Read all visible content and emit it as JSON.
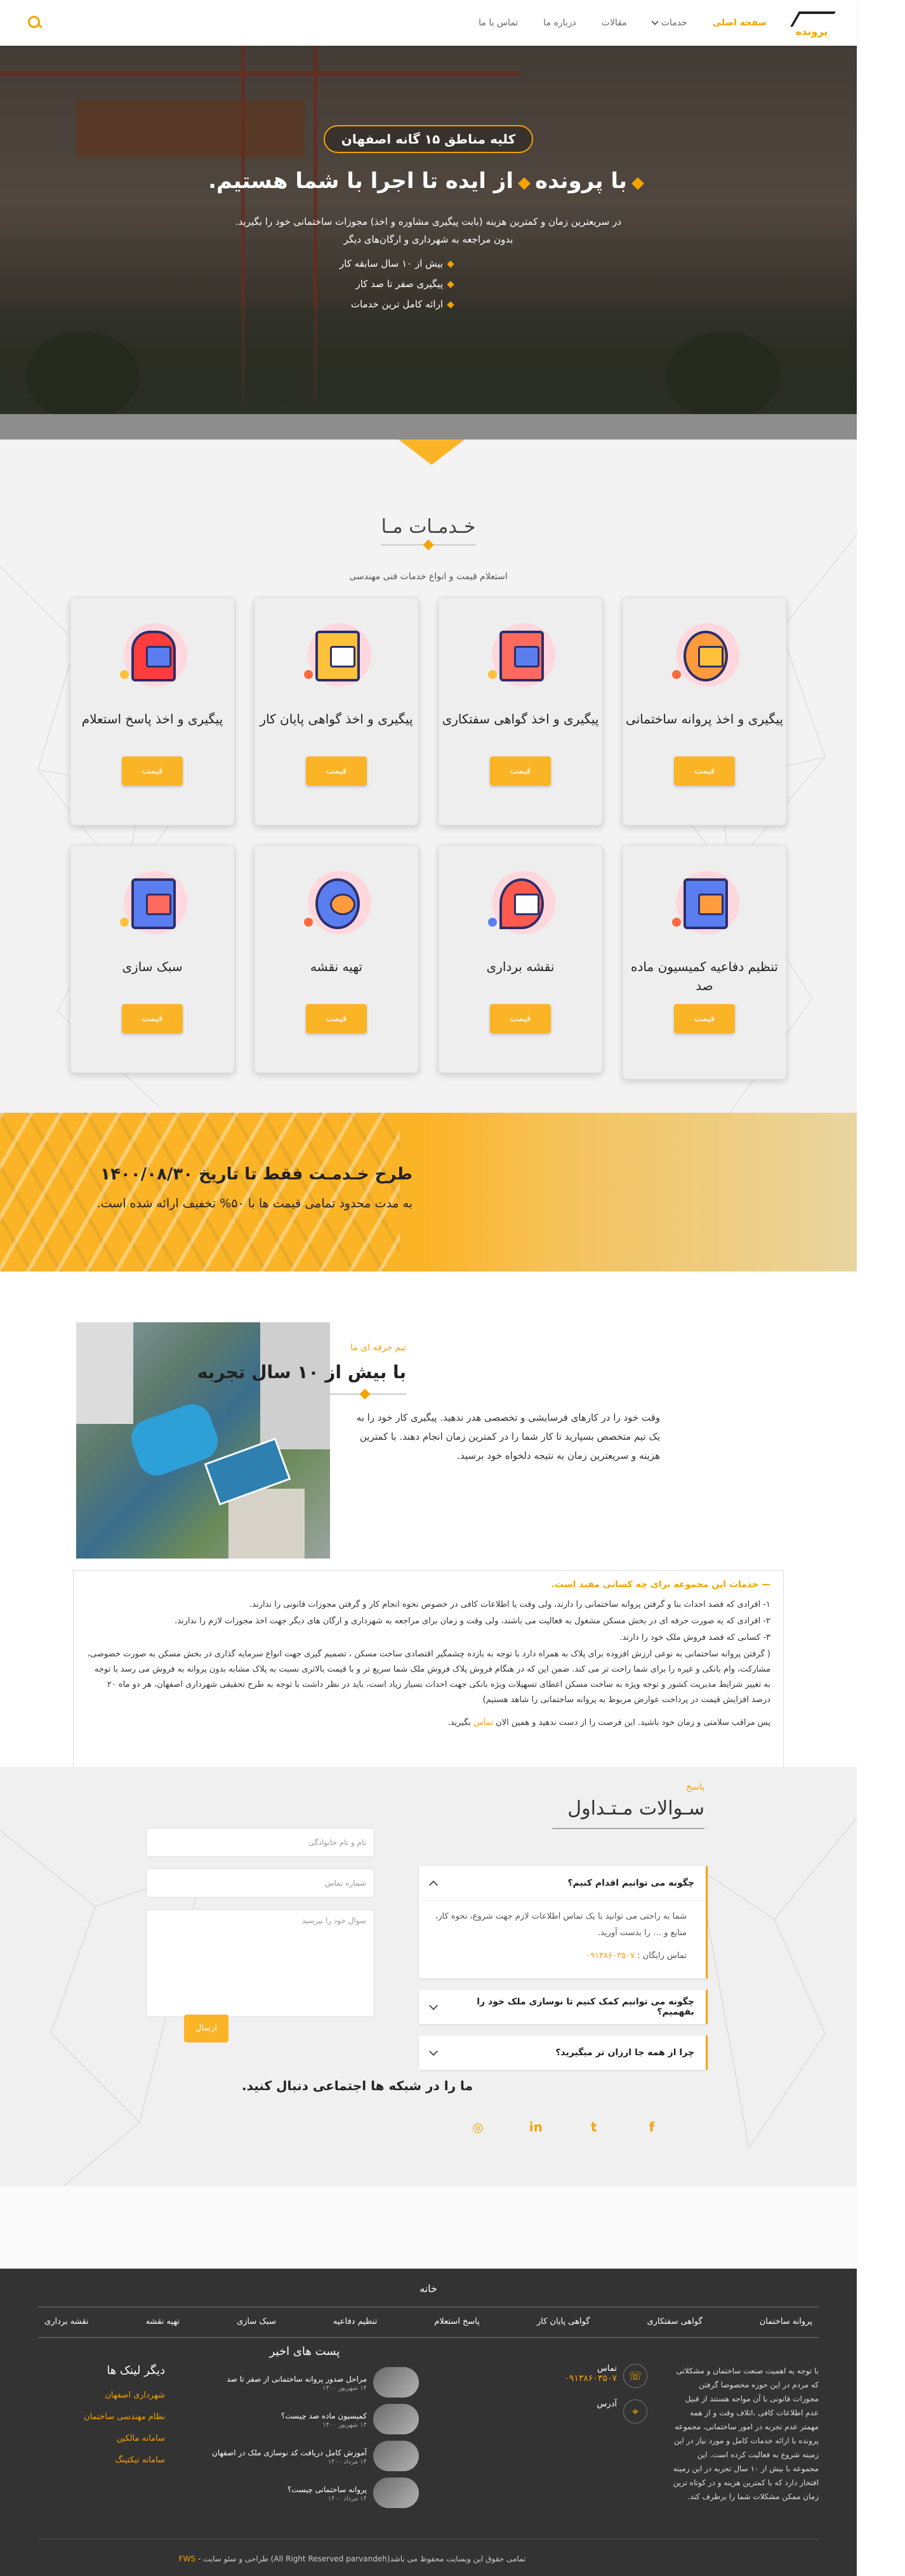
{
  "header": {
    "logo_text": "پرونده",
    "nav": [
      "صفحه اصلی",
      "خدمات",
      "مقالات",
      "درباره ما",
      "تماس با ما"
    ]
  },
  "hero": {
    "pill": "کلیه مناطق ۱۵ گانه اصفهان",
    "title_a": "با پرونده",
    "title_b": "از ایده تا اجرا با شما هستیم.",
    "lead1": "در سریعترین زمان و کمترین هزینه (بابت پیگیری مشاوره و اخذ) مجوزات ساختمانی خود را بگیرید.",
    "lead2": "بدون مراجعه به شهرداری و ارگان‌های دیگر",
    "bullets": [
      "بیش از ۱۰ سال سابقه کار",
      "پیگیری صفر تا صد کار",
      "ارائه کامل ترین خدمات"
    ]
  },
  "services": {
    "title": "خـدمـات مـا",
    "subtitle": "استعلام قیمت و انواع خدمات فنی مهندسی",
    "cards": [
      {
        "title": "پیگیری و اخذ پروانه ساختمانی",
        "btn": "قیمت"
      },
      {
        "title": "پیگیری و اخذ گواهی سفتکاری",
        "btn": "قیمت"
      },
      {
        "title": "پیگیری و اخذ گواهی پایان کار",
        "btn": "قیمت"
      },
      {
        "title": "پیگیری و اخذ پاسخ استعلام",
        "btn": "قیمت"
      },
      {
        "title": "تنظیم دفاعیه کمیسیون ماده صد",
        "btn": "قیمت"
      },
      {
        "title": "نقشه برداری",
        "btn": "قیمت"
      },
      {
        "title": "تهیه نقشه",
        "btn": "قیمت"
      },
      {
        "title": "سبک سازی",
        "btn": "قیمت"
      }
    ]
  },
  "promo": {
    "line1": "طرح خـدمـت فقط تا تاریخ ۱۴۰۰/۰۸/۳۰",
    "line2": "به مدت محدود تمامی قیمت ها با ۵۰% تخفیف ارائه شده است."
  },
  "about": {
    "kicker": "تیم حرفه ای ما",
    "title": "با بیش از ۱۰ سال تجربه",
    "paragraph": "وقت خود را در کارهای فرسایشی و تخصصی هدر ندهید. پیگیری کار خود را به یک تیم متخصص بسپارید تا کار شما را در کمترین زمان انجام دهند. با کمترین هزینه و سریعترین زمان به نتیجه دلخواه خود برسید.",
    "box_title": "خدمات این مجموعه برای چه کسانی مفید است.",
    "box_items": [
      "۱- افرادی که قصد احداث بنا و گرفتن پروانه ساختمانی را دارند، ولی وقت یا اطلاعات کافی در خصوص نحوه انجام کار و گرفتن مجوزات قانونی را ندارند.",
      "۲- افرادی که به صورت حرفه ای در بخش مسکن مشغول به فعالیت می باشند، ولی وقت و زمان برای مراجعه به شهرداری و ارگان های دیگر جهت اخذ مجوزات لازم را ندارند.",
      "۳- کسانی که قصد فروش ملک خود را دارند.",
      "( گرفتن پروانه ساختمانی به نوعی ارزش افزوده برای پلاک به همراه دارد با توجه به بازده چشمگیر اقتصادی ساخت مسکن ، تصمیم گیری جهت انواع سرمایه گذاری در بخش مسکن به صورت خصوصی، مشارکت، وام بانکی و غیره را برای شما راحت تر می کند. ضمن این که در هنگام فروش پلاک فروش ملک شما سریع تر و با قیمت بالاتری نسبت به پلاک مشابه بدون پروانه به فروش می رسد با توجه به تغییر شرایط مدیریت کشور و توجه ویژه به ساخت مسکن اعطای تسهیلات ویژه بانکی جهت احداث بسیار زیاد است، باید در نظر داشت با توجه به طرح تحقیقی شهرداری اصفهان، هر دو ماه ۲۰ درصد افزایش قیمت در پرداخت عوارض مربوط به پروانه ساختمانی را شاهد هستیم)"
    ],
    "cta_before": "پس مراقب سلامتی و زمان خود باشید. این فرصت را از دست ندهید و همین الان",
    "cta_link": "تماس",
    "cta_after": "بگیرید."
  },
  "faq": {
    "kicker": "پاسخ",
    "title": "سـوالات مـتـداول",
    "items": [
      {
        "q": "چگونه می توانیم اقدام کنیم؟",
        "a": "شما به راحتی می توانید با یک تماس اطلاعات لازم جهت شروع، نحوه کار، منابع و … را بدست آورید.",
        "phone_label": "تماس رایگان :",
        "phone": "۰۹۱۳۸۶۰۳۵۰۷"
      },
      {
        "q": "چگونه می توانیم کمک کنیم تا نوسازی ملک خود را بفهمیم؟"
      },
      {
        "q": "چرا از همه جا ارزان تر میگیرید؟"
      }
    ],
    "form": {
      "name_ph": "نام و نام خانوادگی",
      "phone_ph": "شماره تماس",
      "msg_ph": "سوال خود را بپرسید",
      "send": "ارسال"
    },
    "social_title": "ما را در شبکه ها اجتماعی دنبال کنید.",
    "social_icons": [
      "facebook-icon",
      "twitter-icon",
      "linkedin-icon",
      "instagram-icon"
    ]
  },
  "footer": {
    "title": "خانه",
    "links": [
      "پروانه ساختمان",
      "گواهی سفتکاری",
      "گواهی پایان کار",
      "پاسخ استعلام",
      "تنظیم دفاعیه",
      "سبک سازی",
      "تهیه نقشه",
      "نقشه برداری"
    ],
    "about_text": "با توجه به اهمیت صنعت ساختمان و مشکلاتی که مردم در این حوزه مخصوصا گرفتن مجوزات قانونی با آن مواجه هستند از قبیل عدم اطلاعات کافی ،اتلاف وقت و از همه مهمتر عدم تجربه در امور ساختمانی، مجموعه پرونده با ارائه خدمات کامل و مورد نیاز در این زمینه شروع به فعالیت کرده است. این مجموعه با بیش از ۱۰ سال تجربه در این زمینه افتخار دارد که با کمترین هزینه و در کوتاه ترین زمان ممکن مشکلات شما را برطرف کند.",
    "contact_label": "تماس",
    "contact_phone": "۰۹۱۳۸۶۰۳۵۰۷",
    "address_label": "آدرس",
    "posts_title": "پست های اخیر",
    "posts": [
      {
        "title": "مراحل صدور پروانه ساختمانی از صفر تا صد",
        "date": "۱۴ شهریور ۱۴۰۰"
      },
      {
        "title": "کمیسیون ماده صد چیست؟",
        "date": "۱۴ شهریور ۱۴۰۰"
      },
      {
        "title": "آموزش کامل دریافت کد نوسازی ملک در اصفهان",
        "date": "۱۴ مرداد ۱۴۰۰"
      },
      {
        "title": "پروانه ساختمانی چیست؟",
        "date": "۱۴ مرداد ۱۴۰۰"
      }
    ],
    "links_title": "دیگر لینک ها",
    "other_links": [
      "شهرداری اصفهان",
      "نظام مهندسی ساختمان",
      "سامانه مالکین",
      "سامانه تیکتینگ"
    ],
    "copyright": "تمامی حقوق این وبسایت محفوظ می باشد(All Right Reserved parvandeh) طراحی و سئو سایت -",
    "copyright_brand": "FWS"
  }
}
